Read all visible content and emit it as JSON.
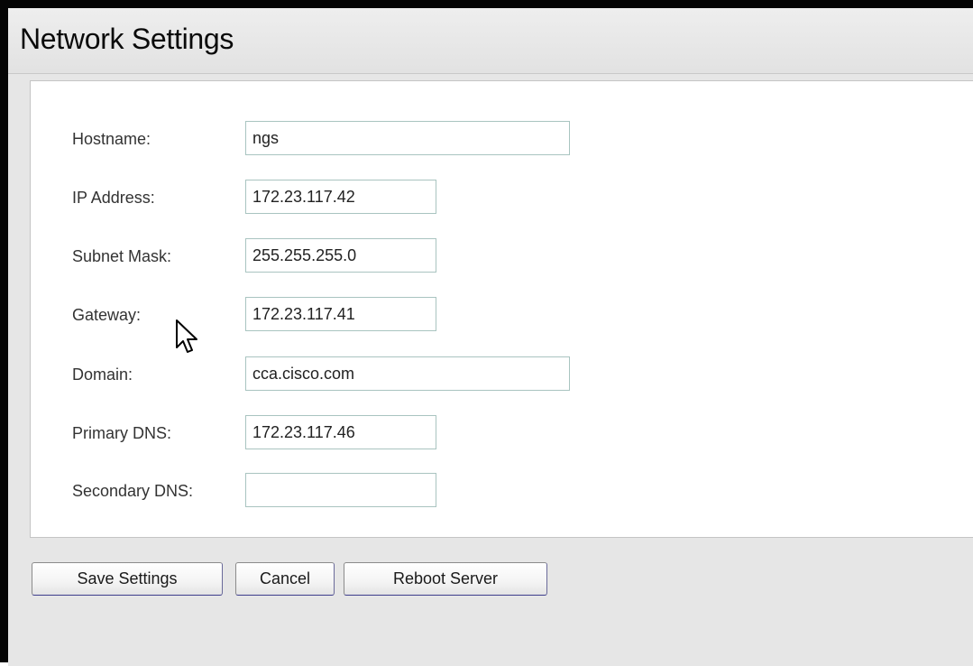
{
  "header": {
    "title": "Network Settings"
  },
  "form": {
    "fields": [
      {
        "label": "Hostname:",
        "value": "ngs"
      },
      {
        "label": "IP Address:",
        "value": "172.23.117.42"
      },
      {
        "label": "Subnet Mask:",
        "value": "255.255.255.0"
      },
      {
        "label": "Gateway:",
        "value": "172.23.117.41"
      },
      {
        "label": "Domain:",
        "value": "cca.cisco.com"
      },
      {
        "label": "Primary DNS:",
        "value": "172.23.117.46"
      },
      {
        "label": "Secondary DNS:",
        "value": ""
      }
    ]
  },
  "buttons": {
    "save": "Save Settings",
    "cancel": "Cancel",
    "reboot": "Reboot Server"
  },
  "icons": {
    "cursor": "mouse-pointer-icon"
  },
  "colors": {
    "border": "#050505",
    "page_background": "#e6e6e6",
    "panel_background": "#ffffff",
    "input_border": "#a9c4c0"
  }
}
